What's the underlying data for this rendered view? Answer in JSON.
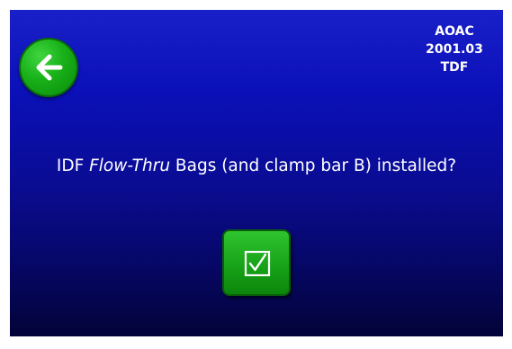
{
  "header": {
    "method_line1": "AOAC",
    "method_line2": "2001.03",
    "method_line3": "TDF"
  },
  "prompt": {
    "prefix": "IDF ",
    "italic": "Flow-Thru",
    "suffix": " Bags (and clamp bar B) installed?"
  },
  "icons": {
    "back": "arrow-left-icon",
    "confirm": "checkbox-checked-icon"
  },
  "colors": {
    "background_top": "#1a20c8",
    "background_bottom": "#030338",
    "button_green": "#18b018",
    "text": "#ffffff"
  }
}
